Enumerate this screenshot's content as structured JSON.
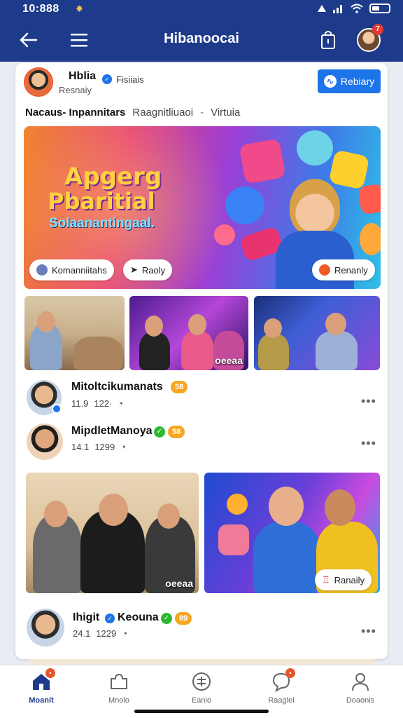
{
  "status": {
    "time": "10:888",
    "notif_icon": "sun-icon"
  },
  "header": {
    "title": "Hibanoocai",
    "badge": "7"
  },
  "post": {
    "author": "Hblia",
    "handle": "Fisiiais",
    "sub": "Resnaiy",
    "follow_label": "Rebiary"
  },
  "tabs": {
    "a": "Nacaus- Inpannitars",
    "b": "Raagnitliuaoi",
    "sep": "-",
    "c": "Virtuia"
  },
  "banner": {
    "title_line1": "Apgerg",
    "title_line2": "Pbaritial",
    "subtitle": "Solaanantingaal.",
    "chip_left": "Komanniitahs",
    "chip_mid": "Raoly",
    "chip_right": "Renanly"
  },
  "grid_caption": "oeeaa",
  "users": [
    {
      "name": "Mitoltcikumanats",
      "badge": "58",
      "stat1": "11.9",
      "stat2": "122·"
    },
    {
      "name": "MipdletManoya",
      "badge": "58",
      "stat1": "14.1",
      "stat2": "1299"
    },
    {
      "name": "Ihigit",
      "name2": "Keouna",
      "badge": "89",
      "stat1": "24.1",
      "stat2": "1229"
    }
  ],
  "big_photos": {
    "caption_left": "oeeaa",
    "chip_right": "Ranaily"
  },
  "nav": [
    {
      "label": "Moanit",
      "active": true,
      "badge": ""
    },
    {
      "label": "Mnolo",
      "active": false,
      "badge": ""
    },
    {
      "label": "Eanio",
      "active": false,
      "badge": ""
    },
    {
      "label": "Raaglei",
      "active": false,
      "badge": ""
    },
    {
      "label": "Doaonis",
      "active": false,
      "badge": ""
    }
  ],
  "colors": {
    "brand": "#1e3a8a",
    "accent": "#1d73e8",
    "badge": "#f6a623",
    "verified": "#2eb82e"
  }
}
